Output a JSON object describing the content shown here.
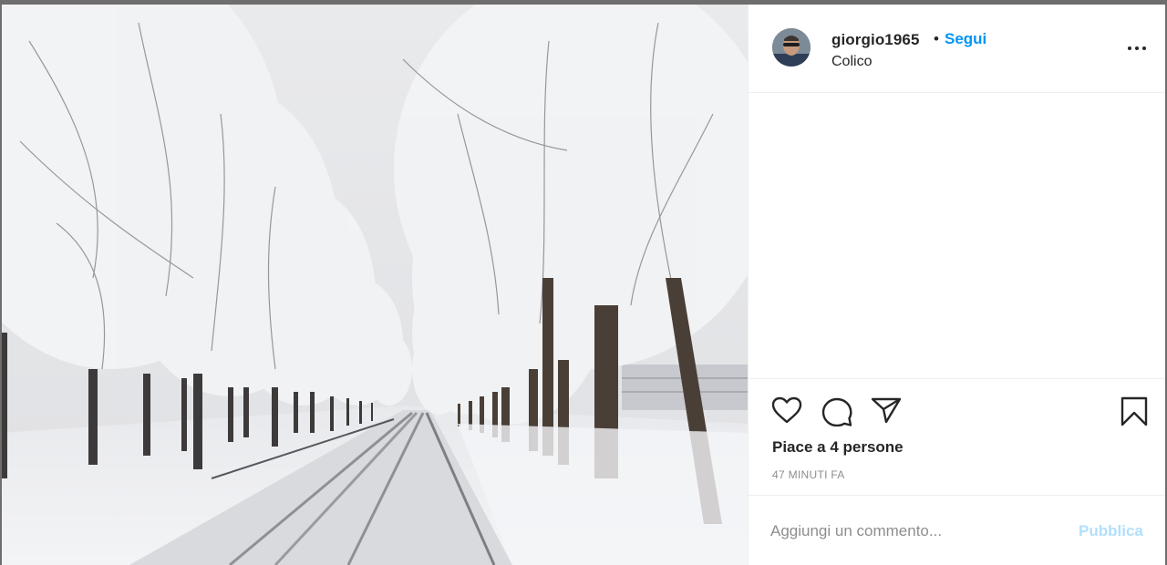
{
  "post": {
    "photo_icon": "snowy-tree-lined-road-photo",
    "author": {
      "username": "giorgio1965",
      "separator": "•",
      "follow_label": "Segui",
      "location": "Colico"
    },
    "likes_text": "Piace a 4 persone",
    "time_text": "47 MINUTI FA",
    "comment": {
      "placeholder": "Aggiungi un commento...",
      "value": "",
      "publish_label": "Pubblica"
    },
    "icons": {
      "like": "heart-icon",
      "comment": "comment-bubble-icon",
      "share": "paper-plane-icon",
      "save": "bookmark-icon",
      "more": "more-options-icon"
    }
  },
  "colors": {
    "accent": "#0095f6",
    "publish_disabled": "#b2dffc",
    "text": "#262626",
    "muted": "#8e8e8e"
  }
}
